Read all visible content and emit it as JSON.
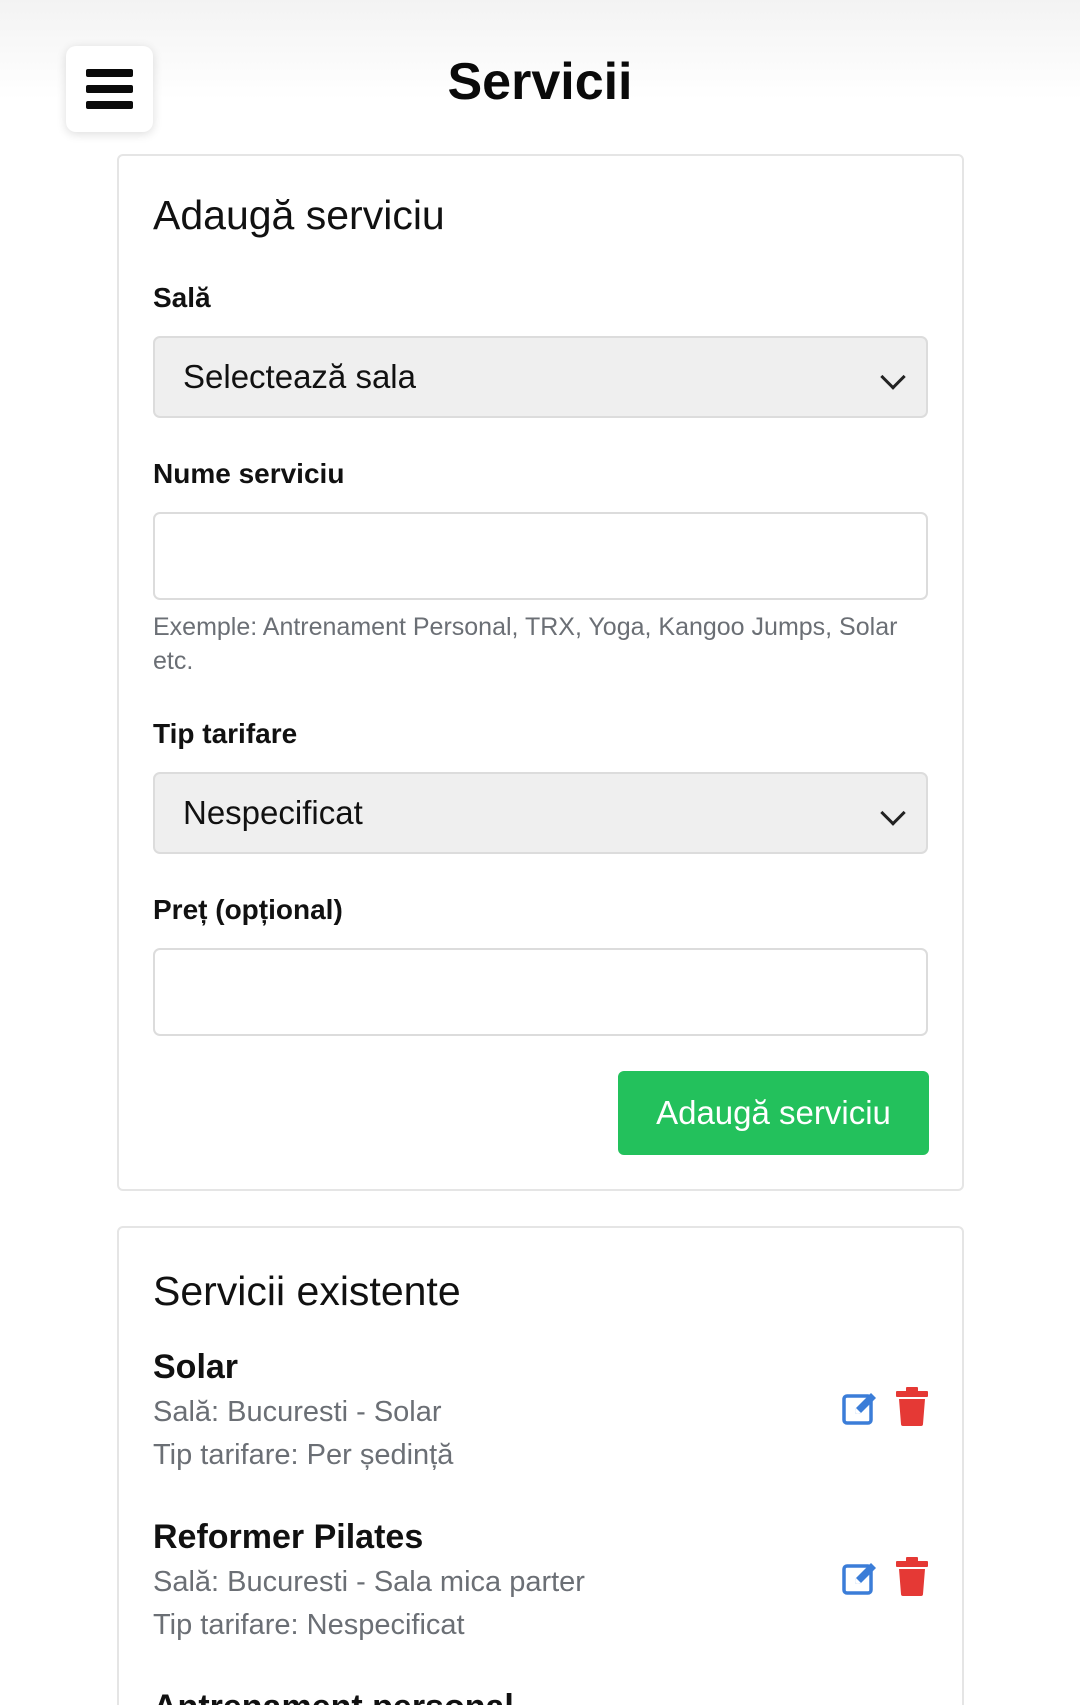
{
  "header": {
    "title": "Servicii",
    "menu_icon": "hamburger-menu-icon"
  },
  "add_form": {
    "title": "Adaugă serviciu",
    "hall_label": "Sală",
    "hall_select_value": "Selectează sala",
    "name_label": "Nume serviciu",
    "name_value": "",
    "name_hint": "Exemple: Antrenament Personal, TRX, Yoga, Kangoo Jumps, Solar etc.",
    "pricing_label": "Tip tarifare",
    "pricing_select_value": "Nespecificat",
    "price_label": "Preț (opțional)",
    "price_value": "",
    "submit_label": "Adaugă serviciu"
  },
  "existing": {
    "title": "Servicii existente",
    "items": [
      {
        "name": "Solar",
        "hall": "Sală: Bucuresti - Solar",
        "pricing": "Tip tarifare: Per ședință"
      },
      {
        "name": "Reformer Pilates",
        "hall": "Sală: Bucuresti - Sala mica parter",
        "pricing": "Tip tarifare: Nespecificat"
      },
      {
        "name": "Antrenament personal"
      }
    ]
  },
  "colors": {
    "accent_green": "#23c15c",
    "edit_blue": "#3b7dd8",
    "delete_red": "#e53935"
  }
}
